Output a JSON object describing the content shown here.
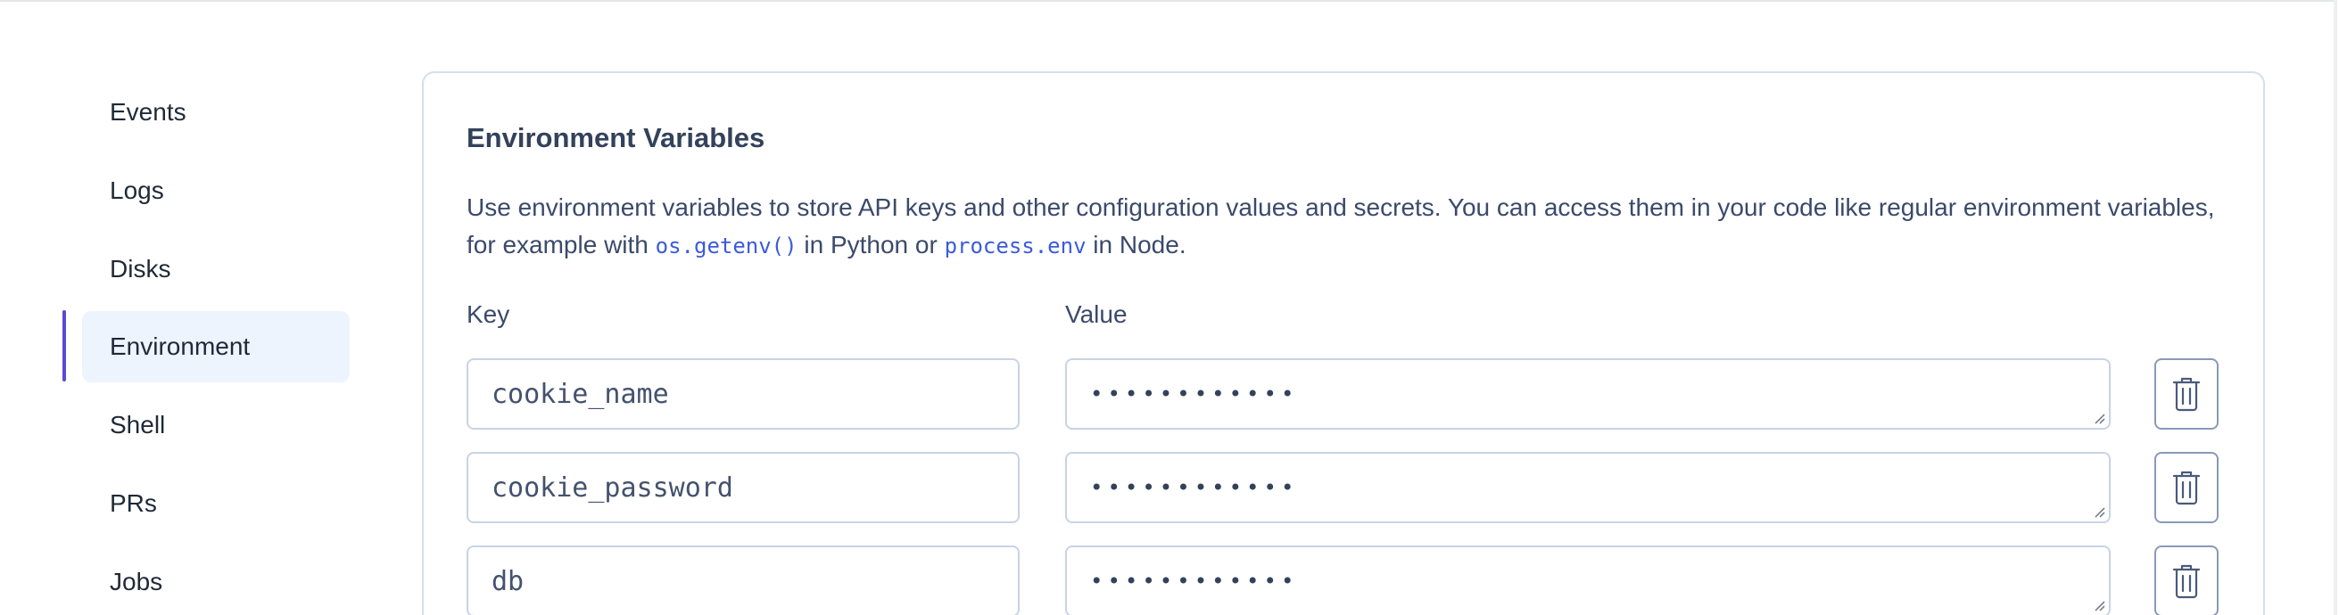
{
  "sidebar": {
    "items": [
      {
        "label": "Events",
        "active": false
      },
      {
        "label": "Logs",
        "active": false
      },
      {
        "label": "Disks",
        "active": false
      },
      {
        "label": "Environment",
        "active": true
      },
      {
        "label": "Shell",
        "active": false
      },
      {
        "label": "PRs",
        "active": false
      },
      {
        "label": "Jobs",
        "active": false
      }
    ]
  },
  "env": {
    "title": "Environment Variables",
    "desc_part1": "Use environment variables to store API keys and other configuration values and secrets. You can access them in your code like regular environment variables, for example with ",
    "code1": "os.getenv()",
    "desc_part2": " in Python or ",
    "code2": "process.env",
    "desc_part3": " in Node.",
    "key_label": "Key",
    "value_label": "Value",
    "rows": [
      {
        "key": "cookie_name",
        "value": "••••••••••••"
      },
      {
        "key": "cookie_password",
        "value": "••••••••••••"
      },
      {
        "key": "db",
        "value": "••••••••••••"
      }
    ]
  },
  "colors": {
    "accent": "#5b4bd6",
    "active_bg": "#eef4fe",
    "card_border": "#d4deed",
    "code": "#3b5bdb"
  },
  "icons": {
    "delete": "trash-icon"
  }
}
